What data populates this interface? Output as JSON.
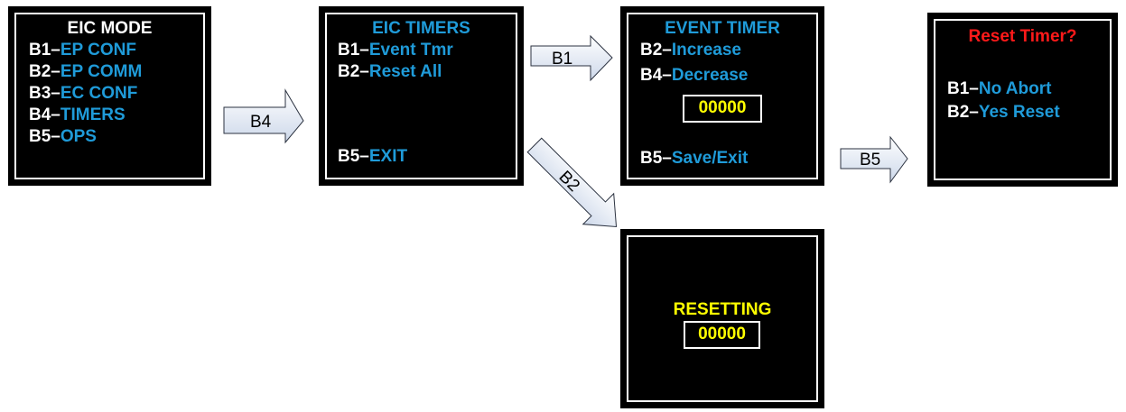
{
  "screens": {
    "eic_mode": {
      "title": "EIC MODE",
      "lines": [
        {
          "key": "B1–",
          "value": "EP CONF"
        },
        {
          "key": "B2–",
          "value": "EP COMM"
        },
        {
          "key": "B3–",
          "value": "EC CONF"
        },
        {
          "key": "B4–",
          "value": "TIMERS"
        },
        {
          "key": "B5–",
          "value": "OPS"
        }
      ]
    },
    "eic_timers": {
      "title": "EIC TIMERS",
      "lines": [
        {
          "key": "B1–",
          "value": "Event Tmr"
        },
        {
          "key": "B2–",
          "value": "Reset All"
        },
        {
          "key": "B5–",
          "value": "EXIT"
        }
      ]
    },
    "event_timer": {
      "title": "EVENT TIMER",
      "lines": [
        {
          "key": "B2–",
          "value": "Increase"
        },
        {
          "key": "B4–",
          "value": "Decrease"
        },
        {
          "key": "B5–",
          "value": "Save/Exit"
        }
      ],
      "counter": "00000"
    },
    "reset_timer": {
      "title": "Reset Timer?",
      "lines": [
        {
          "key": "B1–",
          "value": "No Abort"
        },
        {
          "key": "B2–",
          "value": "Yes Reset"
        }
      ]
    },
    "resetting": {
      "title": "RESETTING",
      "counter": "00000"
    }
  },
  "arrows": {
    "b4": "B4",
    "b1": "B1",
    "b2": "B2",
    "b5": "B5"
  },
  "colors": {
    "screen_bg": "#000000",
    "label_white": "#ffffff",
    "value_blue": "#1f9bd9",
    "counter_yellow": "#ffff00",
    "alert_red": "#ff1a1a",
    "arrow_fill": "#dde5f2"
  }
}
